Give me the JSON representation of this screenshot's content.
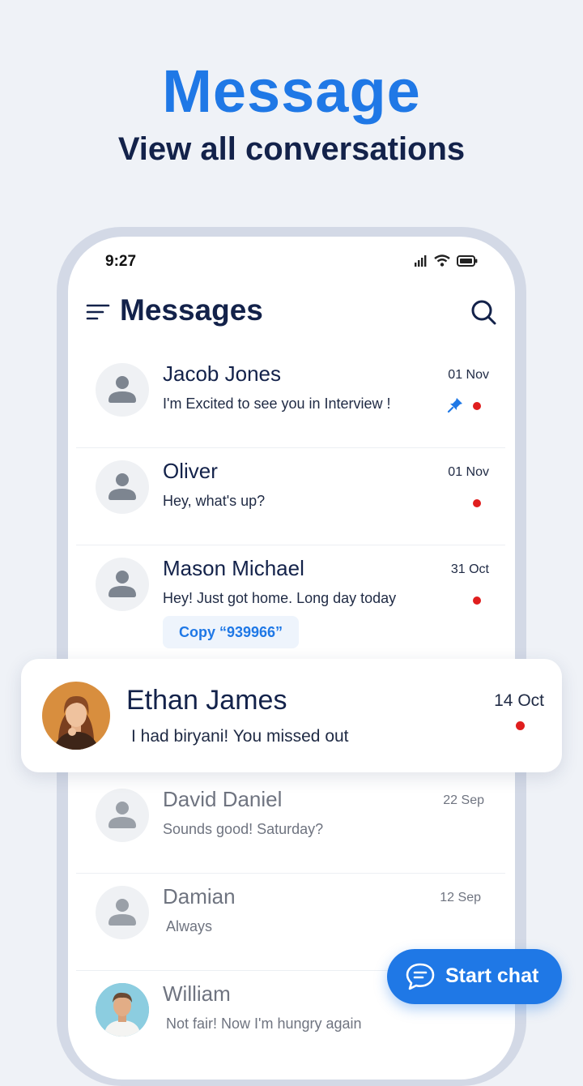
{
  "hero": {
    "title": "Message",
    "subtitle": "View all conversations"
  },
  "status_bar": {
    "time": "9:27",
    "icons": [
      "signal-icon",
      "wifi-icon",
      "battery-icon"
    ]
  },
  "header": {
    "title": "Messages",
    "menu_icon": "menu-icon",
    "search_icon": "search-icon"
  },
  "conversations": [
    {
      "name": "Jacob Jones",
      "message": "I'm Excited to see you in Interview !",
      "date": "01 Nov",
      "pinned": true,
      "unread": true
    },
    {
      "name": "Oliver",
      "message": "Hey, what's up?",
      "date": "01 Nov",
      "pinned": false,
      "unread": true
    },
    {
      "name": "Mason Michael",
      "message": "Hey! Just got home. Long day today",
      "date": "31 Oct",
      "pinned": false,
      "unread": true,
      "chip": "Copy “939966”"
    },
    {
      "name": "David Daniel",
      "message": "Sounds good! Saturday?",
      "date": "22 Sep",
      "pinned": false,
      "unread": false
    },
    {
      "name": "Damian",
      "message": "Always",
      "date": "12 Sep",
      "pinned": false,
      "unread": false
    },
    {
      "name": "William",
      "message": "Not fair! Now I'm hungry again",
      "date": "",
      "pinned": false,
      "unread": false
    }
  ],
  "featured": {
    "name": "Ethan James",
    "message": "I had biryani! You missed out",
    "date": "14 Oct",
    "unread": true
  },
  "fab": {
    "label": "Start chat",
    "icon": "chat-bubble-icon"
  },
  "colors": {
    "accent": "#1f78e6",
    "navy": "#13224a",
    "unread": "#e01e1e",
    "background": "#eff2f7"
  }
}
